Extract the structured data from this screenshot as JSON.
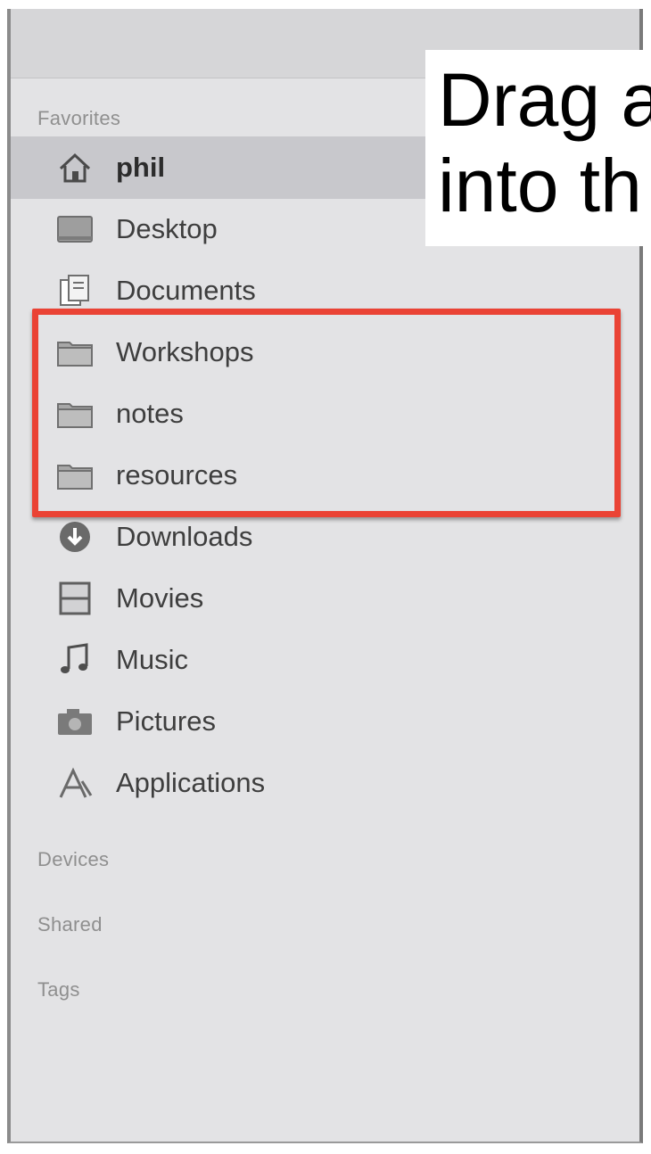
{
  "sidebar": {
    "sections": {
      "favorites": "Favorites",
      "devices": "Devices",
      "shared": "Shared",
      "tags": "Tags"
    },
    "items": [
      {
        "label": "phil",
        "icon": "home-icon",
        "selected": true
      },
      {
        "label": "Desktop",
        "icon": "desktop-icon",
        "selected": false
      },
      {
        "label": "Documents",
        "icon": "documents-icon",
        "selected": false
      },
      {
        "label": "Workshops",
        "icon": "folder-icon",
        "selected": false
      },
      {
        "label": "notes",
        "icon": "folder-icon",
        "selected": false
      },
      {
        "label": "resources",
        "icon": "folder-icon",
        "selected": false
      },
      {
        "label": "Downloads",
        "icon": "downloads-icon",
        "selected": false
      },
      {
        "label": "Movies",
        "icon": "movies-icon",
        "selected": false
      },
      {
        "label": "Music",
        "icon": "music-icon",
        "selected": false
      },
      {
        "label": "Pictures",
        "icon": "pictures-icon",
        "selected": false
      },
      {
        "label": "Applications",
        "icon": "applications-icon",
        "selected": false
      }
    ]
  },
  "callout": {
    "line1": "Drag a",
    "line2": "into th"
  },
  "colors": {
    "highlight": "#ea4335",
    "sidebar_bg": "#e3e3e5",
    "selected_bg": "#c8c8cc"
  }
}
